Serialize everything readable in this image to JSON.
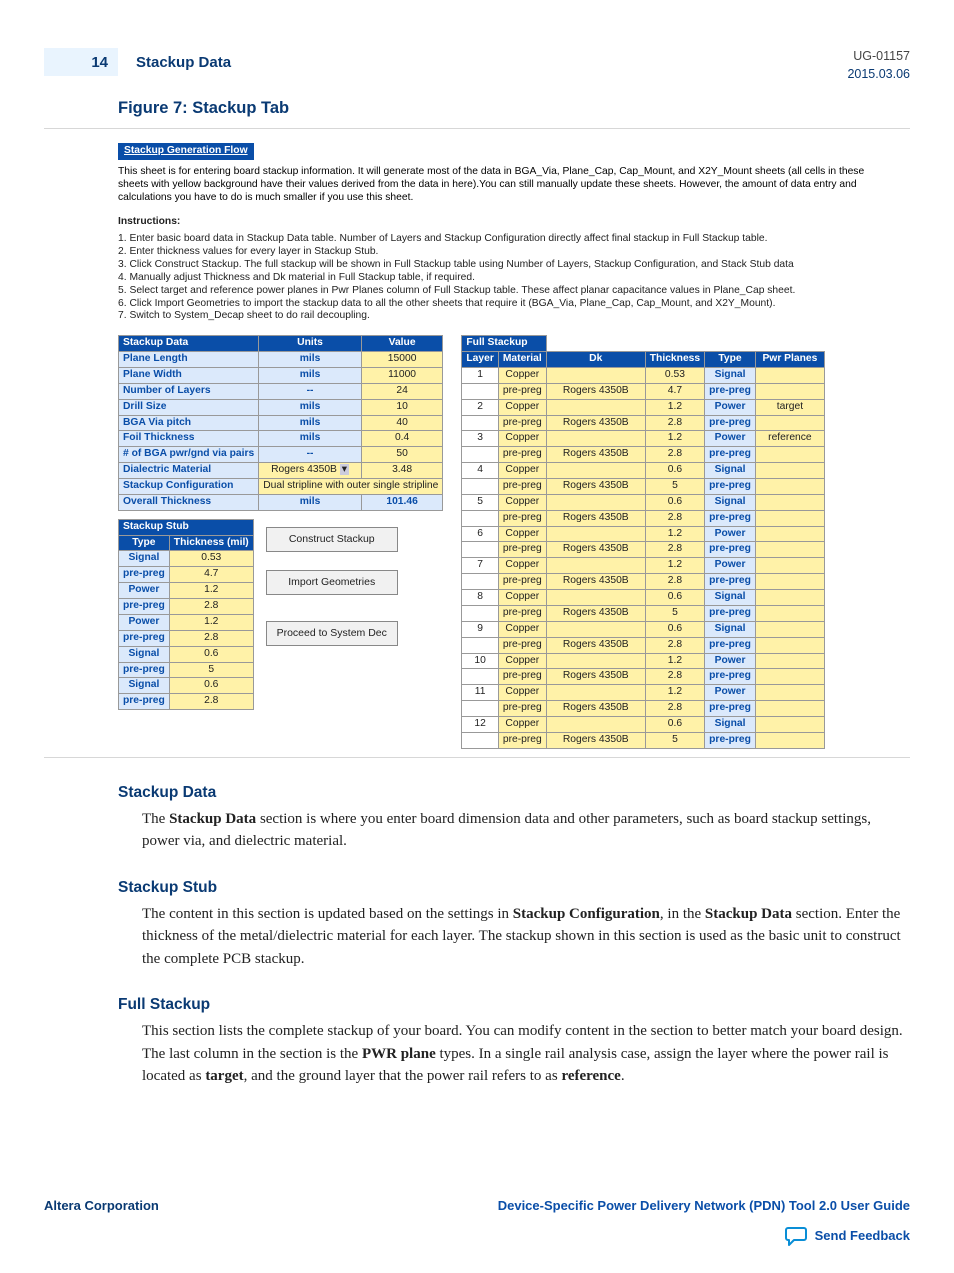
{
  "header": {
    "page_number": "14",
    "section": "Stackup Data",
    "doc_id": "UG-01157",
    "date": "2015.03.06"
  },
  "figure_title": "Figure 7: Stackup Tab",
  "flow": {
    "title": "Stackup Generation Flow",
    "intro": [
      "This sheet is for entering board stackup information. It will generate most of the data in BGA_Via, Plane_Cap, Cap_Mount, and X2Y_Mount sheets (all cells in these sheets with yellow background have their values derived from the data in here).You can still manually update these sheets. However, the amount of data entry and calculations you have to do is much smaller if you use this sheet."
    ],
    "instructions_title": "Instructions:",
    "steps": [
      "1. Enter basic board data in Stackup Data table. Number of Layers and Stackup Configuration directly affect final stackup in Full Stackup table.",
      "2. Enter thickness values for every layer in Stackup Stub.",
      "3. Click Construct Stackup. The full stackup will be shown in Full Stackup table using Number of Layers, Stackup Configuration, and Stack Stub data",
      "4. Manually adjust Thickness and Dk material in Full Stackup table, if required.",
      "5. Select target and reference power planes in Pwr Planes column of Full Stackup table. These affect planar capacitance values in Plane_Cap sheet.",
      "6. Click Import Geometries to import the stackup data to all the other sheets that require it (BGA_Via, Plane_Cap, Cap_Mount, and X2Y_Mount).",
      "7. Switch to System_Decap sheet to do rail decoupling."
    ]
  },
  "stackup_data": {
    "title": "Stackup Data",
    "cols": [
      "Units",
      "Value"
    ],
    "rows": [
      {
        "label": "Plane Length",
        "units": "mils",
        "value": "15000"
      },
      {
        "label": "Plane Width",
        "units": "mils",
        "value": "11000"
      },
      {
        "label": "Number of Layers",
        "units": "--",
        "value": "24"
      },
      {
        "label": "Drill Size",
        "units": "mils",
        "value": "10"
      },
      {
        "label": "BGA Via pitch",
        "units": "mils",
        "value": "40"
      },
      {
        "label": "Foil Thickness",
        "units": "mils",
        "value": "0.4"
      },
      {
        "label": "# of BGA pwr/gnd via pairs",
        "units": "--",
        "value": "50"
      },
      {
        "label": "Dialectric Material",
        "units": "Rogers 4350B",
        "value": "3.48"
      },
      {
        "label": "Stackup Configuration",
        "units": "Dual stripline with outer single stripline",
        "value": ""
      },
      {
        "label": "Overall Thickness",
        "units": "mils",
        "value": "101.46"
      }
    ]
  },
  "stackup_stub": {
    "title": "Stackup Stub",
    "cols": [
      "Type",
      "Thickness (mil)"
    ],
    "rows": [
      {
        "t": "Signal",
        "v": "0.53"
      },
      {
        "t": "pre-preg",
        "v": "4.7"
      },
      {
        "t": "Power",
        "v": "1.2"
      },
      {
        "t": "pre-preg",
        "v": "2.8"
      },
      {
        "t": "Power",
        "v": "1.2"
      },
      {
        "t": "pre-preg",
        "v": "2.8"
      },
      {
        "t": "Signal",
        "v": "0.6"
      },
      {
        "t": "pre-preg",
        "v": "5"
      },
      {
        "t": "Signal",
        "v": "0.6"
      },
      {
        "t": "pre-preg",
        "v": "2.8"
      }
    ]
  },
  "buttons": {
    "construct": "Construct Stackup",
    "import": "Import Geometries",
    "proceed": "Proceed to System Dec"
  },
  "full_stackup": {
    "title": "Full Stackup",
    "cols": [
      "Layer",
      "Material",
      "Dk",
      "Thickness",
      "Type",
      "Pwr Planes"
    ],
    "rows": [
      {
        "l": "1",
        "m": "Copper",
        "dk": "",
        "th": "0.53",
        "ty": "Signal",
        "pp": ""
      },
      {
        "l": "",
        "m": "pre-preg",
        "dk": "Rogers 4350B",
        "th": "4.7",
        "ty": "pre-preg",
        "pp": ""
      },
      {
        "l": "2",
        "m": "Copper",
        "dk": "",
        "th": "1.2",
        "ty": "Power",
        "pp": "target"
      },
      {
        "l": "",
        "m": "pre-preg",
        "dk": "Rogers 4350B",
        "th": "2.8",
        "ty": "pre-preg",
        "pp": ""
      },
      {
        "l": "3",
        "m": "Copper",
        "dk": "",
        "th": "1.2",
        "ty": "Power",
        "pp": "reference"
      },
      {
        "l": "",
        "m": "pre-preg",
        "dk": "Rogers 4350B",
        "th": "2.8",
        "ty": "pre-preg",
        "pp": ""
      },
      {
        "l": "4",
        "m": "Copper",
        "dk": "",
        "th": "0.6",
        "ty": "Signal",
        "pp": ""
      },
      {
        "l": "",
        "m": "pre-preg",
        "dk": "Rogers 4350B",
        "th": "5",
        "ty": "pre-preg",
        "pp": ""
      },
      {
        "l": "5",
        "m": "Copper",
        "dk": "",
        "th": "0.6",
        "ty": "Signal",
        "pp": ""
      },
      {
        "l": "",
        "m": "pre-preg",
        "dk": "Rogers 4350B",
        "th": "2.8",
        "ty": "pre-preg",
        "pp": ""
      },
      {
        "l": "6",
        "m": "Copper",
        "dk": "",
        "th": "1.2",
        "ty": "Power",
        "pp": ""
      },
      {
        "l": "",
        "m": "pre-preg",
        "dk": "Rogers 4350B",
        "th": "2.8",
        "ty": "pre-preg",
        "pp": ""
      },
      {
        "l": "7",
        "m": "Copper",
        "dk": "",
        "th": "1.2",
        "ty": "Power",
        "pp": ""
      },
      {
        "l": "",
        "m": "pre-preg",
        "dk": "Rogers 4350B",
        "th": "2.8",
        "ty": "pre-preg",
        "pp": ""
      },
      {
        "l": "8",
        "m": "Copper",
        "dk": "",
        "th": "0.6",
        "ty": "Signal",
        "pp": ""
      },
      {
        "l": "",
        "m": "pre-preg",
        "dk": "Rogers 4350B",
        "th": "5",
        "ty": "pre-preg",
        "pp": ""
      },
      {
        "l": "9",
        "m": "Copper",
        "dk": "",
        "th": "0.6",
        "ty": "Signal",
        "pp": ""
      },
      {
        "l": "",
        "m": "pre-preg",
        "dk": "Rogers 4350B",
        "th": "2.8",
        "ty": "pre-preg",
        "pp": ""
      },
      {
        "l": "10",
        "m": "Copper",
        "dk": "",
        "th": "1.2",
        "ty": "Power",
        "pp": ""
      },
      {
        "l": "",
        "m": "pre-preg",
        "dk": "Rogers 4350B",
        "th": "2.8",
        "ty": "pre-preg",
        "pp": ""
      },
      {
        "l": "11",
        "m": "Copper",
        "dk": "",
        "th": "1.2",
        "ty": "Power",
        "pp": ""
      },
      {
        "l": "",
        "m": "pre-preg",
        "dk": "Rogers 4350B",
        "th": "2.8",
        "ty": "pre-preg",
        "pp": ""
      },
      {
        "l": "12",
        "m": "Copper",
        "dk": "",
        "th": "0.6",
        "ty": "Signal",
        "pp": ""
      },
      {
        "l": "",
        "m": "pre-preg",
        "dk": "Rogers 4350B",
        "th": "5",
        "ty": "pre-preg",
        "pp": ""
      }
    ]
  },
  "sections": {
    "sd": {
      "h": "Stackup Data",
      "p": "The Stackup Data section is where you enter board dimension data and other parameters, such as board stackup settings, power via, and dielectric material."
    },
    "ss": {
      "h": "Stackup Stub",
      "p": "The content in this section is updated based on the settings in Stackup Configuration, in the Stackup Data section. Enter the thickness of the metal/dielectric material for each layer. The stackup shown in this section is used as the basic unit to construct the complete PCB stackup."
    },
    "fs": {
      "h": "Full Stackup",
      "p": "This section lists the complete stackup of your board. You can modify content in the section to better match your board design. The last column in the section is the PWR plane types. In a single rail analysis case, assign the layer where the power rail is located as target, and the ground layer that the power rail refers to as reference."
    }
  },
  "footer": {
    "left": "Altera Corporation",
    "right": "Device-Specific Power Delivery Network (PDN) Tool 2.0 User Guide",
    "feedback": "Send Feedback"
  }
}
